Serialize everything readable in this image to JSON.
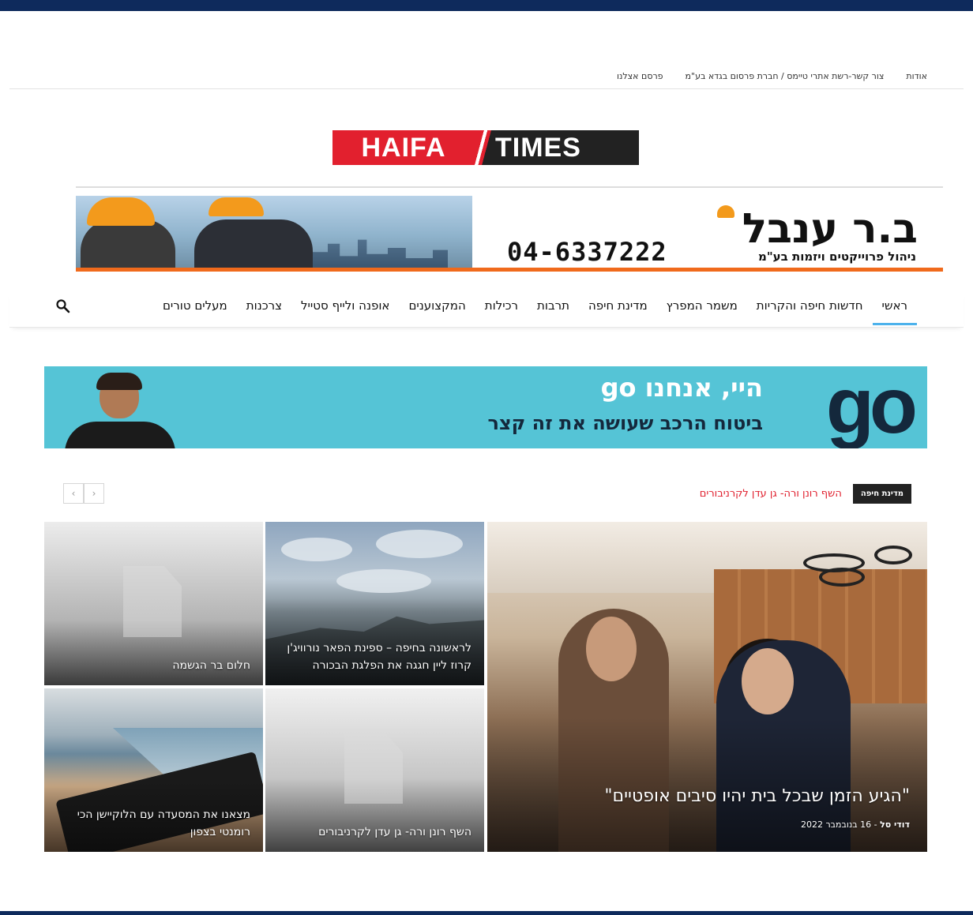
{
  "top_links": {
    "about": "אודות",
    "contact": "צור קשר-רשת אתרי טיימס / חברת פרסום בגדא בע\"מ",
    "advertise": "פרסם אצלנו"
  },
  "logo": {
    "left": "HAIFA",
    "right": "TIMES"
  },
  "banner_top": {
    "phone": "04-6337222",
    "brand": "ב.ר ענבל",
    "tagline": "ניהול פרוייקטים ויזמות בע\"מ"
  },
  "nav": {
    "items": [
      "ראשי",
      "חדשות חיפה והקריות",
      "משמר המפרץ",
      "מדינת חיפה",
      "תרבות",
      "רכילות",
      "המקצוענים",
      "אופנה ולייף סטייל",
      "צרכנות",
      "מעלים טורים"
    ],
    "active_index": 0,
    "search_icon": "search-icon"
  },
  "banner_go": {
    "logo": "go",
    "line1": "היי, אנחנו go",
    "line2": "ביטוח הרכב שעושה את זה קצר"
  },
  "ticker": {
    "tag": "מדינת חיפה",
    "headline": "השף רונן ורה- גן עדן לקרניבורים",
    "prev_icon": "‹",
    "next_icon": "›"
  },
  "tiles": {
    "main": {
      "title": "\"הגיע הזמן שבכל בית יהיו סיבים אופטיים\"",
      "author": "דודי סל",
      "separator": " - ",
      "date": "16 בנובמבר 2022"
    },
    "ship": "לראשונה בחיפה – ספינת הפאר נורוויג'ן קרוז ליין חגגה את הפלגת הבכורה",
    "rain": "חלום בר הגשמה",
    "chef": "השף רונן ורה- גן עדן לקרניבורים",
    "food": "מצאנו את המסעדה עם הלוקיישן הכי רומנטי בצפון"
  },
  "colors": {
    "top_bar": "#0e2a5c",
    "accent": "#4db2ec",
    "ticker_red": "#e0202e",
    "logo_red": "#e2202e"
  }
}
